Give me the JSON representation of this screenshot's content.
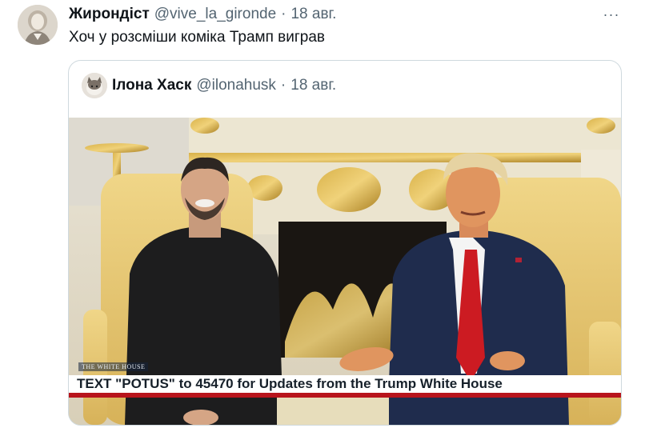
{
  "tweet": {
    "author_name": "Жирондіст",
    "handle": "@vive_la_gironde",
    "separator": "·",
    "date": "18 авг.",
    "more_icon": "···",
    "text": "Хоч у розсміши коміка Трамп виграв"
  },
  "quoted": {
    "author_name": "Ілона Хаск",
    "handle": "@ilonahusk",
    "separator": "·",
    "date": "18 авг.",
    "media": {
      "watermark": "THE WHITE HOUSE",
      "caption": "TEXT \"POTUS\" to 45470 for Updates from the Trump White House"
    }
  },
  "colors": {
    "text_primary": "#0f1419",
    "text_secondary": "#536471",
    "border": "#cfd9de",
    "caption_red": "#b8141c"
  }
}
